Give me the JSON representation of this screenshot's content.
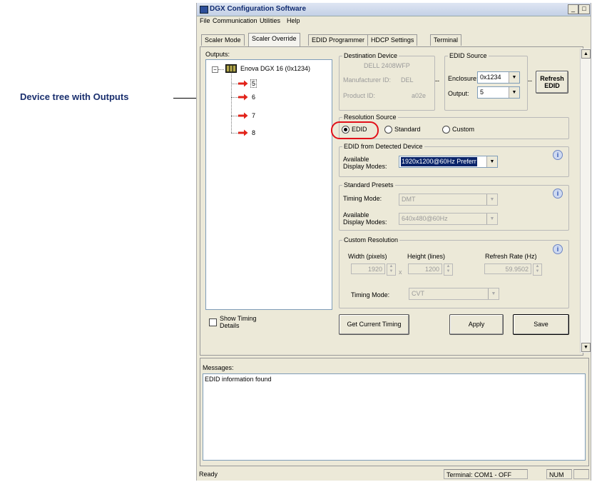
{
  "annotation": {
    "callout_text": "Device tree with Outputs"
  },
  "window": {
    "title": "DGX Configuration Software",
    "buttons": {
      "minimize": "_",
      "maximize": "□"
    }
  },
  "menu": [
    "File",
    "Communication",
    "Utilities",
    "Help"
  ],
  "tabs": [
    "Scaler Mode",
    "Scaler Override",
    "EDID Programmer",
    "HDCP Settings",
    "Terminal"
  ],
  "active_tab": "Scaler Override",
  "outputs": {
    "label": "Outputs:",
    "root": "Enova DGX 16 (0x1234)",
    "items": [
      "5",
      "6",
      "7",
      "8"
    ],
    "selected": "5"
  },
  "show_timing": {
    "label_line1": "Show Timing",
    "label_line2": "Details",
    "checked": false
  },
  "destination_device": {
    "legend": "Destination Device",
    "model": "DELL 2408WFP",
    "manufacturer_label": "Manufacturer ID:",
    "manufacturer_value": "DEL",
    "product_label": "Product ID:",
    "product_value": "a02e",
    "separator": "--"
  },
  "edid_source": {
    "legend": "EDID Source",
    "enclosure_label": "Enclosure:",
    "enclosure_value": "0x1234",
    "output_label": "Output:",
    "output_value": "5",
    "separator": "--",
    "refresh_line1": "Refresh",
    "refresh_line2": "EDID"
  },
  "resolution_source": {
    "legend": "Resolution Source",
    "options": [
      "EDID",
      "Standard",
      "Custom"
    ],
    "selected": "EDID"
  },
  "edid_detected": {
    "legend": "EDID from Detected Device",
    "label_line1": "Available",
    "label_line2": "Display Modes:",
    "value": "1920x1200@60Hz Preferr"
  },
  "standard_presets": {
    "legend": "Standard Presets",
    "timing_label": "Timing Mode:",
    "timing_value": "DMT",
    "modes_label_line1": "Available",
    "modes_label_line2": "Display Modes:",
    "modes_value": "640x480@60Hz"
  },
  "custom_resolution": {
    "legend": "Custom Resolution",
    "width_label": "Width (pixels)",
    "width_value": "1920",
    "height_label": "Height (lines)",
    "height_value": "1200",
    "times": "x",
    "refresh_label": "Refresh Rate (Hz)",
    "refresh_value": "59.9502",
    "timing_label": "Timing Mode:",
    "timing_value": "CVT"
  },
  "buttons": {
    "get_current_timing": "Get Current Timing",
    "apply": "Apply",
    "save": "Save"
  },
  "messages": {
    "label": "Messages:",
    "lines": [
      "EDID information found"
    ]
  },
  "status": {
    "left": "Ready",
    "terminal": "Terminal: COM1 - OFF",
    "num": "NUM"
  },
  "colors": {
    "arrow": "#e2231a",
    "highlight_ring": "#e2101a",
    "selection": "#0a246a",
    "callout_text": "#1a2f6e"
  },
  "icons": {
    "tree_arrow": "red-arrow-icon",
    "device": "device-icon",
    "info": "info-icon",
    "dropdown": "chevron-down-icon"
  }
}
